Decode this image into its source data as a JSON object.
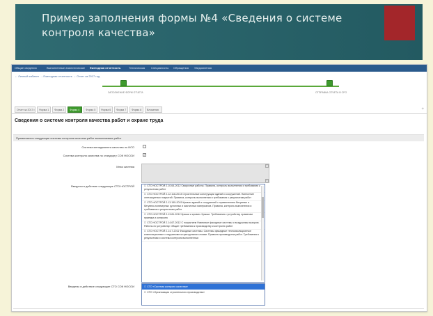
{
  "slide": {
    "title_line1": "Пример заполнения формы №4 «Сведения о системе",
    "title_line2": "контроля качества»",
    "accent_color": "#a3262a",
    "band_color": "#2f6b72"
  },
  "nav": {
    "items": [
      "Общие сведения",
      "Выполненные аналитические",
      "Ежегодная отчетность",
      "Техническая",
      "Специалисты",
      "Обращения",
      "Уведомления"
    ]
  },
  "breadcrumb": "← Личный кабинет → Ежегодная отчетность → Отчет за 2017 год",
  "progress": {
    "start_label": "ЗАПОЛНЕНИЕ ФОРМ ОТЧЕТА",
    "end_label": "ОТПРАВКА ОТЧЕТА В СРО"
  },
  "tabs": {
    "items": [
      "Отчет за 2017 г.",
      "Форма 1",
      "Форма 2",
      "Форма 4",
      "Форма 5",
      "Форма 6",
      "Форма 7",
      "Форма 8",
      "Вложения"
    ],
    "active_index": 3,
    "add_icon": "+"
  },
  "page": {
    "title": "Сведения о системе контроля качества работ и охране труда",
    "section_header": "Применяются следующие системы контроля качества работ выполняемых работ"
  },
  "form": {
    "iso_label": "Система менеджмента качества по ИСО",
    "sok_label": "Система контроля качества по стандарту СОК НОСОИ",
    "other_label": "Иная система",
    "sto_label": "Введены в действие следующие СТО НОСТРОЙ",
    "sok_sto_label": "Введены в действие следующие СТО СОК НОСОИ",
    "sok_checked_mark": "✓",
    "sto_list": [
      "☐ СТО НОСТРОЙ 2.10.64-2012 Сварочные работы. Правила, контроль выполнения и требования к результатам работ",
      "☐ СТО НОСТРОЙ 2.12.118-2013 Строительные конструкции зданий и сооружений. Нанесение огнезащитных покрытий. Правила, контроль выполнения и требования к результатам работ",
      "☐ СТО НОСТРОЙ 2.13.155-2015 Кровли зданий и сооружений с применением битумных и битумно-полимерных рулонных и мастичных материалов. Правила, контроль выполнения и требования к результатам работ",
      "☐ СТО НОСТРОЙ 2.13.81-2012 Крыши и кровли. Крыши. Требования к устройству, правилам приемки и контролю",
      "☐ СТО НОСТРОЙ 2.14.67-2012 С покрытием Навесные фасадные системы с воздушным зазором. Работы по устройству. Общие требования к производству и контролю работ",
      "☐ СТО НОСТРОЙ 2.14.7-2011 Фасадные системы. Системы фасадные теплоизоляционные композиционные с наружными штукатурными слоями. Правила производства работ. Требования к результатам и система контроля выполненных"
    ],
    "sok_list": [
      "☐ СТО «Система контроля качества»",
      "☐ СТО «Организация строительного производства»"
    ],
    "sok_selected_index": 0
  }
}
